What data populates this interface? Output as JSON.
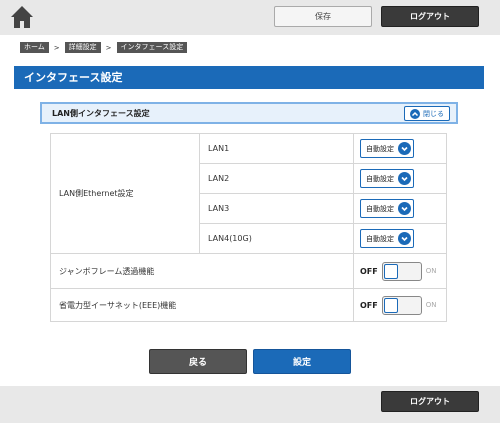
{
  "header": {
    "save_label": "保存",
    "logout_label": "ログアウト"
  },
  "breadcrumb": {
    "items": [
      "ホーム",
      "詳細設定",
      "インタフェース設定"
    ],
    "separator": ">"
  },
  "page": {
    "title": "インタフェース設定"
  },
  "section": {
    "title": "LAN側インタフェース設定",
    "close_label": "閉じる"
  },
  "ethernet": {
    "label": "LAN側Ethernet設定",
    "ports": [
      {
        "name": "LAN1",
        "value": "自動設定"
      },
      {
        "name": "LAN2",
        "value": "自動設定"
      },
      {
        "name": "LAN3",
        "value": "自動設定"
      },
      {
        "name": "LAN4(10G)",
        "value": "自動設定"
      }
    ]
  },
  "jumbo": {
    "label": "ジャンボフレーム透過機能",
    "off_label": "OFF",
    "on_label": "ON",
    "state": "OFF"
  },
  "eee": {
    "label": "省電力型イーサネット(EEE)機能",
    "off_label": "OFF",
    "on_label": "ON",
    "state": "OFF"
  },
  "actions": {
    "back_label": "戻る",
    "set_label": "設定"
  },
  "footer": {
    "logout_label": "ログアウト"
  },
  "colors": {
    "accent": "#1b6ab8",
    "dark_button": "#3a3a3a",
    "bar_background": "#e8e8e8"
  },
  "icons": [
    "home-icon",
    "chevron-up-icon",
    "chevron-down-icon"
  ]
}
